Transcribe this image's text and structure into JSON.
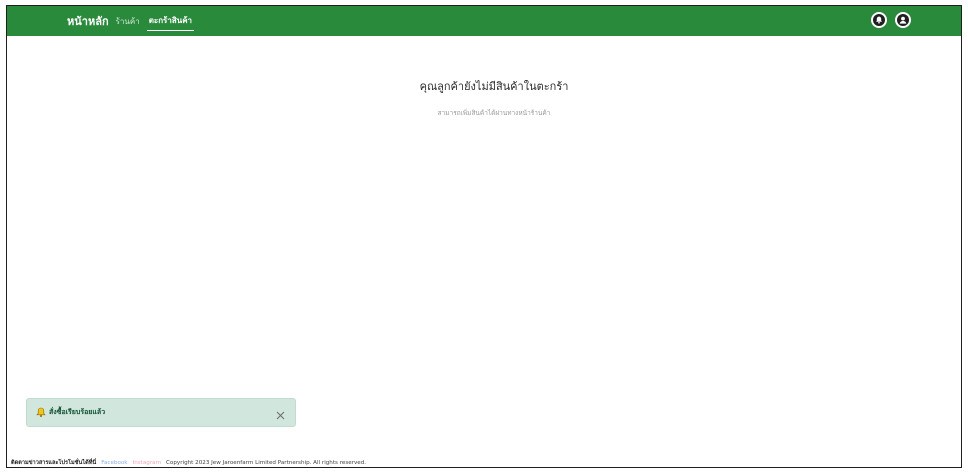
{
  "navbar": {
    "brand": "หน้าหลัก",
    "items": [
      {
        "label": "ร้านค้า"
      },
      {
        "label": "ตะกร้าสินค้า"
      }
    ],
    "icons": [
      "notification-bell-icon",
      "user-icon"
    ],
    "color": "#2a8a3c"
  },
  "cart": {
    "empty_title": "คุณลูกค้ายังไม่มีสินค้าในตะกร้า",
    "empty_subtitle": "สามารถเพิ่มสินค้าได้ผ่านทางหน้าร้านค้า"
  },
  "toast": {
    "icon": "bell-icon",
    "message": "สั่งซื้อเรียบร้อยแล้ว",
    "close_icon": "close-icon",
    "color": "#d1e7dd"
  },
  "footer": {
    "follow_text": "ติดตามข่าวสารและโปรโมชั่นได้ที่นี่",
    "facebook": "Facebook",
    "instagram": "Instagram",
    "copyright": "Copyright 2023 Jew Jaroenfarm Limited Partnership. All rights reserved."
  }
}
